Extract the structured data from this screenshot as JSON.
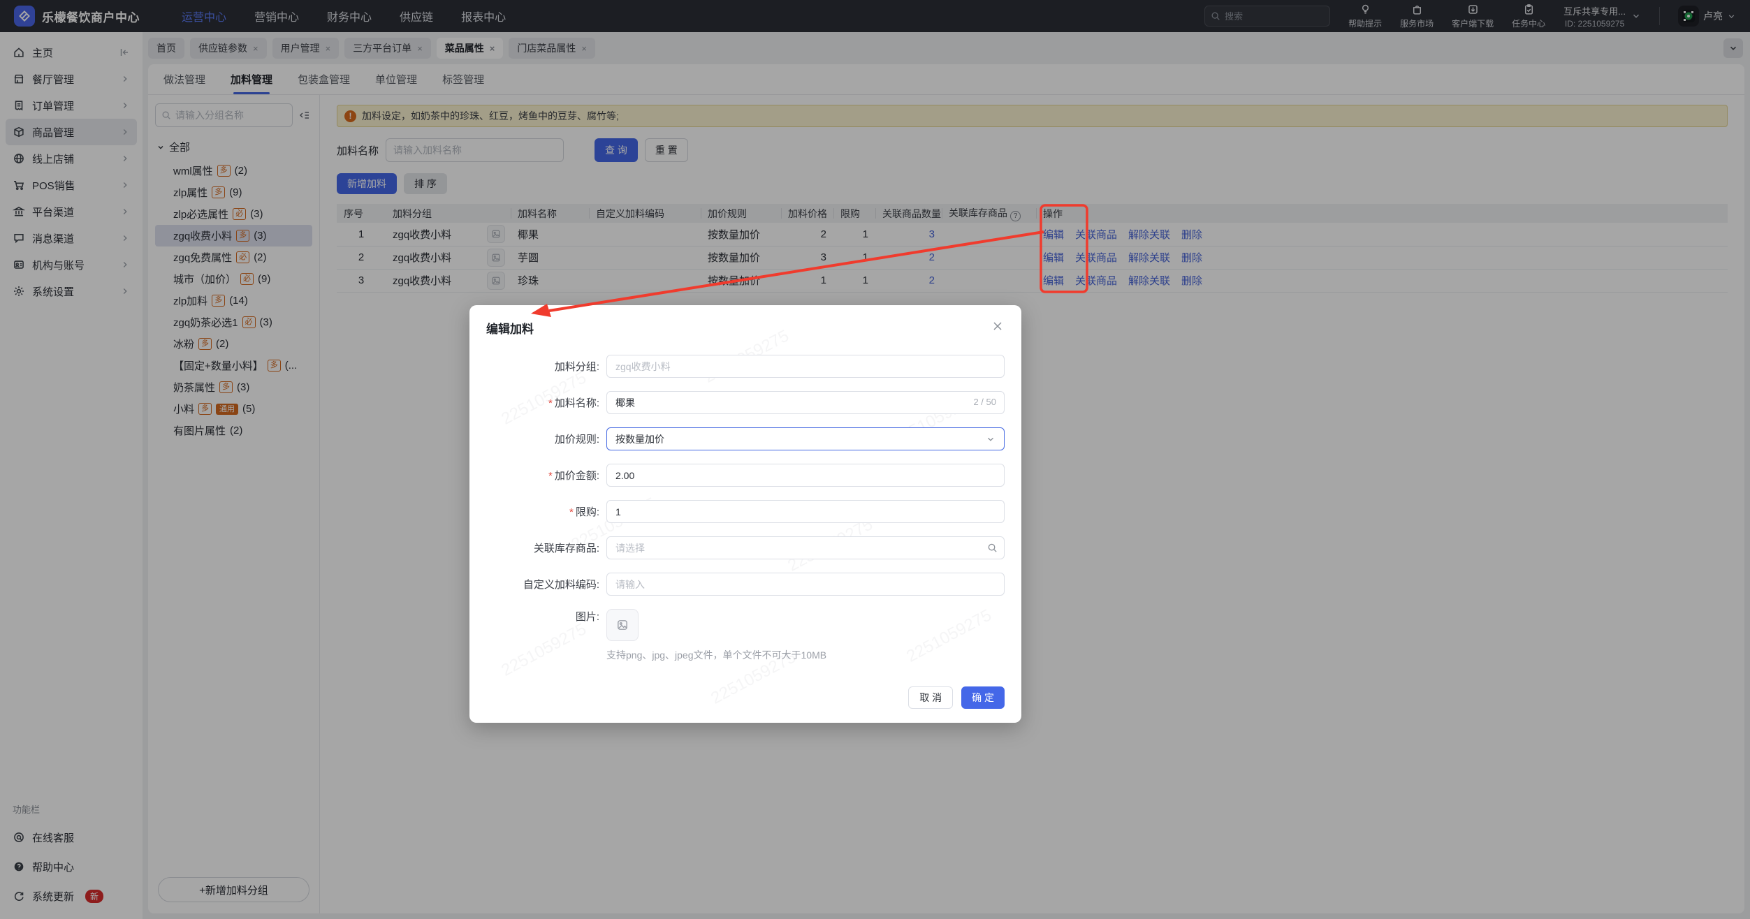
{
  "icons": {
    "exclam": "!",
    "question": "?",
    "close": "×"
  },
  "topbar": {
    "logo_text": "乐檬餐饮商户中心",
    "nav": [
      "运营中心",
      "营销中心",
      "财务中心",
      "供应链",
      "报表中心"
    ],
    "search_placeholder": "搜索",
    "utilities": [
      "帮助提示",
      "服务市场",
      "客户端下载",
      "任务中心"
    ],
    "store_name": "互斥共享专用...",
    "store_id": "ID: 2251059275",
    "username": "卢亮"
  },
  "tabs": [
    "首页",
    "供应链参数",
    "用户管理",
    "三方平台订单",
    "菜品属性",
    "门店菜品属性"
  ],
  "subtabs": [
    "做法管理",
    "加料管理",
    "包装盒管理",
    "单位管理",
    "标签管理"
  ],
  "sidebar": {
    "items": [
      "主页",
      "餐厅管理",
      "订单管理",
      "商品管理",
      "线上店铺",
      "POS销售",
      "平台渠道",
      "消息渠道",
      "机构与账号",
      "系统设置"
    ],
    "footer_title": "功能栏",
    "footer_items": [
      "在线客服",
      "帮助中心",
      "系统更新"
    ],
    "new_badge": "新"
  },
  "panel": {
    "search_placeholder": "请输入分组名称",
    "root_label": "全部",
    "items": [
      {
        "label": "wml属性",
        "badge": "多",
        "count": "(2)"
      },
      {
        "label": "zlp属性",
        "badge": "多",
        "count": "(9)"
      },
      {
        "label": "zlp必选属性",
        "badge": "必",
        "count": "(3)"
      },
      {
        "label": "zgq收费小料",
        "badge": "多",
        "count": "(3)"
      },
      {
        "label": "zgq免费属性",
        "badge": "必",
        "count": "(2)"
      },
      {
        "label": "城市（加价）",
        "badge": "必",
        "count": "(9)"
      },
      {
        "label": "zlp加料",
        "badge": "多",
        "count": "(14)"
      },
      {
        "label": "zgq奶茶必选1",
        "badge": "必",
        "count": "(3)"
      },
      {
        "label": "冰粉",
        "badge": "多",
        "count": "(2)"
      },
      {
        "label": "【固定+数量小料】",
        "badge": "多",
        "count": "(..."
      },
      {
        "label": "奶茶属性",
        "badge": "多",
        "count": "(3)"
      },
      {
        "label": "小料",
        "badge": "多",
        "badge2": "通用",
        "count": "(5)"
      },
      {
        "label": "有图片属性",
        "count": "(2)"
      }
    ],
    "add_button": "+新增加料分组"
  },
  "main": {
    "alert": "加料设定，如奶茶中的珍珠、红豆，烤鱼中的豆芽、腐竹等;",
    "filter_label": "加料名称",
    "filter_placeholder": "请输入加料名称",
    "search_btn": "查 询",
    "reset_btn": "重 置",
    "add_btn": "新增加料",
    "sort_btn": "排 序",
    "table": {
      "headers": [
        "序号",
        "加料分组",
        "",
        "加料名称",
        "自定义加料编码",
        "加价规则",
        "加料价格",
        "限购",
        "关联商品数量",
        "关联库存商品",
        "操作"
      ],
      "ops": [
        "编辑",
        "关联商品",
        "解除关联",
        "删除"
      ],
      "rows": [
        {
          "index": "1",
          "group": "zgq收费小料",
          "name": "椰果",
          "code": "",
          "rule": "按数量加价",
          "price": "2",
          "limit": "1",
          "linked": "3",
          "stock": ""
        },
        {
          "index": "2",
          "group": "zgq收费小料",
          "name": "芋圆",
          "code": "",
          "rule": "按数量加价",
          "price": "3",
          "limit": "1",
          "linked": "2",
          "stock": ""
        },
        {
          "index": "3",
          "group": "zgq收费小料",
          "name": "珍珠",
          "code": "",
          "rule": "按数量加价",
          "price": "1",
          "limit": "1",
          "linked": "2",
          "stock": ""
        }
      ]
    }
  },
  "modal": {
    "title": "编辑加料",
    "required_mark": "*",
    "watermark": "2251059275",
    "fields": {
      "group_label": "加料分组:",
      "group_placeholder": "zgq收费小料",
      "name_label": "加料名称:",
      "name_value": "椰果",
      "name_counter": "2 / 50",
      "rule_label": "加价规则:",
      "rule_value": "按数量加价",
      "amount_label": "加价金额:",
      "amount_value": "2.00",
      "limit_label": "限购:",
      "limit_value": "1",
      "stock_label": "关联库存商品:",
      "stock_placeholder": "请选择",
      "code_label": "自定义加料编码:",
      "code_placeholder": "请输入",
      "image_label": "图片:"
    },
    "upload_hint": "支持png、jpg、jpeg文件，单个文件不可大于10MB",
    "cancel_btn": "取 消",
    "ok_btn": "确 定"
  },
  "colors": {
    "primary": "#4467e8",
    "link": "#4864d8",
    "orange_badge": "#d4691f",
    "annotation_red": "#f03b2d",
    "alert_bg": "#faf3d1",
    "topbar_bg": "#2b2e36"
  }
}
